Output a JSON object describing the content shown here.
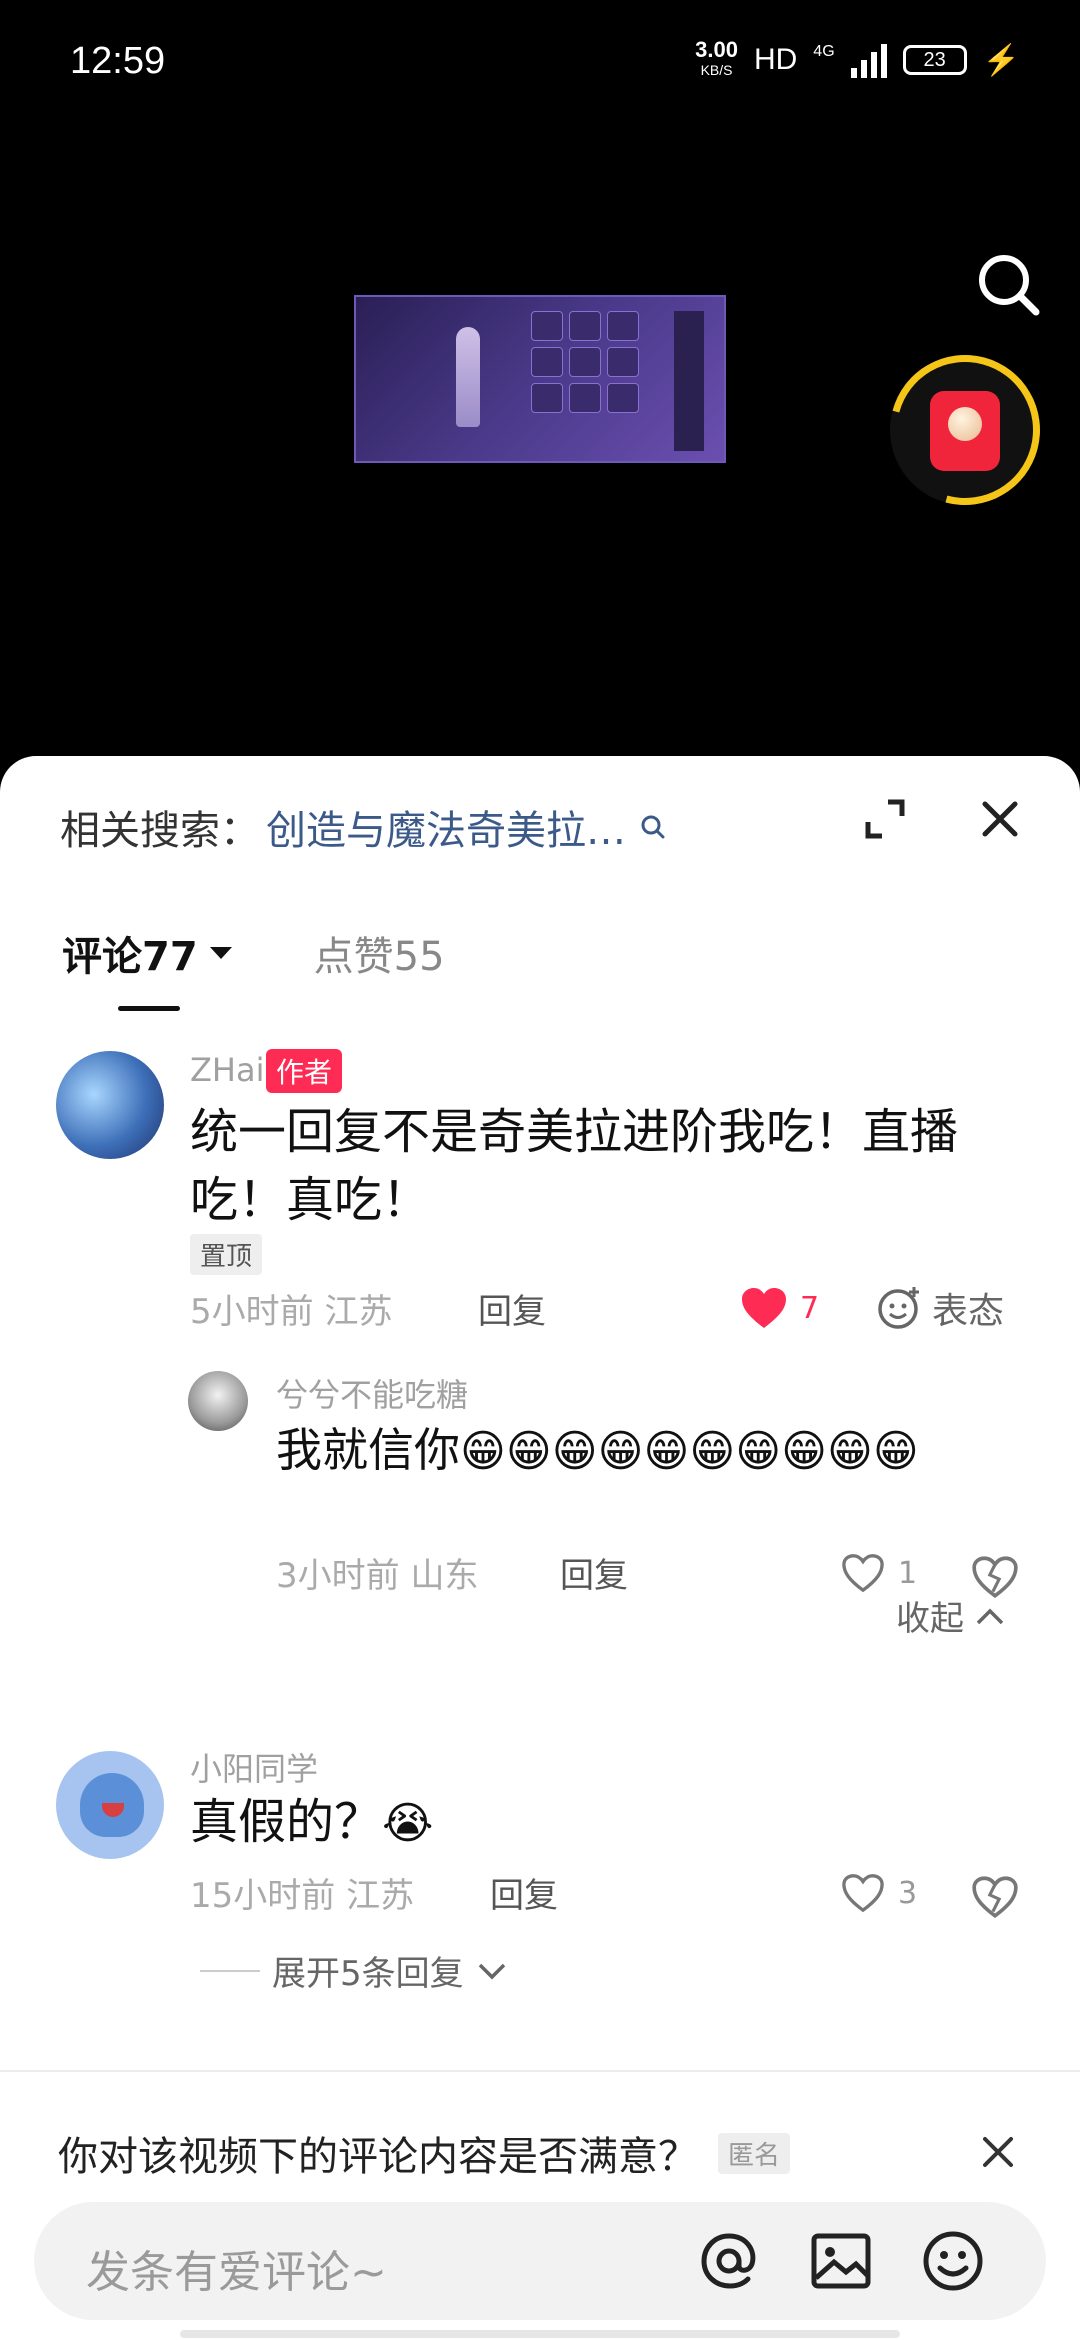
{
  "status": {
    "time": "12:59",
    "net_speed": "3.00",
    "net_unit": "KB/S",
    "hd": "HD",
    "network": "4G",
    "battery": "23"
  },
  "related": {
    "label": "相关搜索：",
    "query": "创造与魔法奇美拉…"
  },
  "tabs": {
    "comments": "评论77",
    "likes": "点赞55"
  },
  "comments": [
    {
      "user": "ZHai",
      "author_badge": "作者",
      "text": "统一回复不是奇美拉进阶我吃！直播吃！真吃！",
      "pinned": "置顶",
      "meta": "5小时前 江苏",
      "reply": "回复",
      "likes": "7",
      "express": "表态",
      "liked": true,
      "replies": [
        {
          "user": "兮兮不能吃糖",
          "text": "我就信你",
          "emoji": "😁😁😁😁😁😁😁😁😁😁",
          "meta": "3小时前 山东",
          "reply": "回复",
          "likes": "1"
        }
      ],
      "collapse": "收起"
    },
    {
      "user": "小阳同学",
      "text": "真假的？",
      "emoji": "😭",
      "meta": "15小时前 江苏",
      "reply": "回复",
      "likes": "3",
      "expand": "展开5条回复"
    }
  ],
  "survey": {
    "question": "你对该视频下的评论内容是否满意？",
    "anon": "匿名"
  },
  "composer": {
    "placeholder": "发条有爱评论~"
  },
  "colors": {
    "accent": "#fe2c55",
    "redpack": "#f0243a",
    "ring": "#f5c518"
  }
}
